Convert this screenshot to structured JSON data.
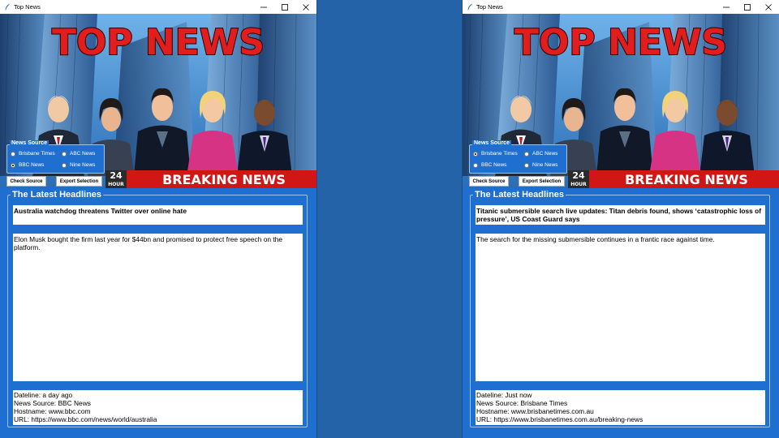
{
  "windows": [
    {
      "title": "Top News",
      "banner": {
        "title": "TOP NEWS",
        "badge_number": "24",
        "badge_text": "HOUR",
        "ticker": "BREAKING NEWS"
      },
      "news_source": {
        "legend": "News Source",
        "options": [
          {
            "label": "Brisbane Times",
            "selected": false
          },
          {
            "label": "ABC News",
            "selected": false
          },
          {
            "label": "BBC News",
            "selected": true
          },
          {
            "label": "Nine News",
            "selected": false
          }
        ]
      },
      "buttons": {
        "check": "Check Source",
        "export": "Export Selection"
      },
      "latest": {
        "legend": "The Latest Headlines",
        "headline": "Australia watchdog threatens Twitter over online hate",
        "body": "Elon Musk bought the firm last year for $44bn and promised to protect free speech on the platform.",
        "dateline": "Dateline: a day ago",
        "source": "News Source: BBC News",
        "hostname": "Hostname: www.bbc.com",
        "url": "URL: https://www.bbc.com/news/world/australia"
      }
    },
    {
      "title": "Top News",
      "banner": {
        "title": "TOP NEWS",
        "badge_number": "24",
        "badge_text": "HOUR",
        "ticker": "BREAKING NEWS"
      },
      "news_source": {
        "legend": "News Source",
        "options": [
          {
            "label": "Brisbane Times",
            "selected": true
          },
          {
            "label": "ABC News",
            "selected": false
          },
          {
            "label": "BBC News",
            "selected": false
          },
          {
            "label": "Nine News",
            "selected": false
          }
        ]
      },
      "buttons": {
        "check": "Check Source",
        "export": "Export Selection"
      },
      "latest": {
        "legend": "The Latest Headlines",
        "headline": "Titanic submersible search live updates: Titan debris found, shows ‘catastrophic loss of pressure’, US Coast Guard says",
        "body": "The search for the missing submersible continues in a frantic race against time.",
        "dateline": "Dateline: Just now",
        "source": "News Source: Brisbane Times",
        "hostname": "Hostname: www.brisbanetimes.com.au",
        "url": "URL: https://www.brisbanetimes.com.au/breaking-news"
      }
    }
  ],
  "icons": {
    "app": "feather-icon",
    "minimize": "minimize-icon",
    "maximize": "maximize-icon",
    "close": "close-icon"
  }
}
